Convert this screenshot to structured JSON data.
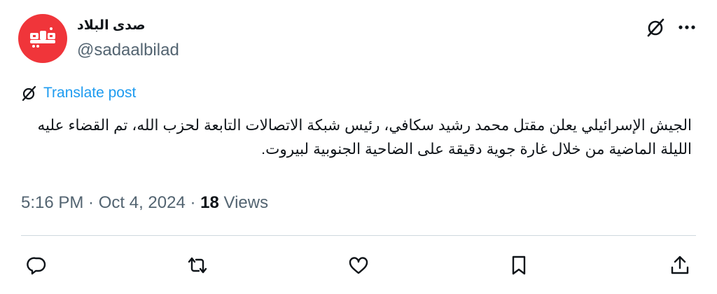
{
  "author": {
    "display_name": "صدى البلاد",
    "handle": "@sadaalbilad",
    "avatar_color": "#f0353a"
  },
  "translate_label": "Translate post",
  "tweet_text": "الجيش الإسرائيلي يعلن مقتل محمد رشيد سكافي، رئيس شبكة الاتصالات التابعة لحزب الله،  تم القضاء عليه الليلة الماضية من خلال غارة جوية دقيقة على الضاحية الجنوبية لبيروت.",
  "meta": {
    "time": "5:16 PM",
    "date": "Oct 4, 2024",
    "views_count": "18",
    "views_label": "Views"
  },
  "icons": {
    "grok": "grok-icon",
    "more": "more-icon",
    "reply": "reply-icon",
    "repost": "repost-icon",
    "like": "like-icon",
    "bookmark": "bookmark-icon",
    "share": "share-icon"
  },
  "colors": {
    "link": "#1d9bf0",
    "secondary_text": "#536471",
    "primary_text": "#0f1419"
  }
}
